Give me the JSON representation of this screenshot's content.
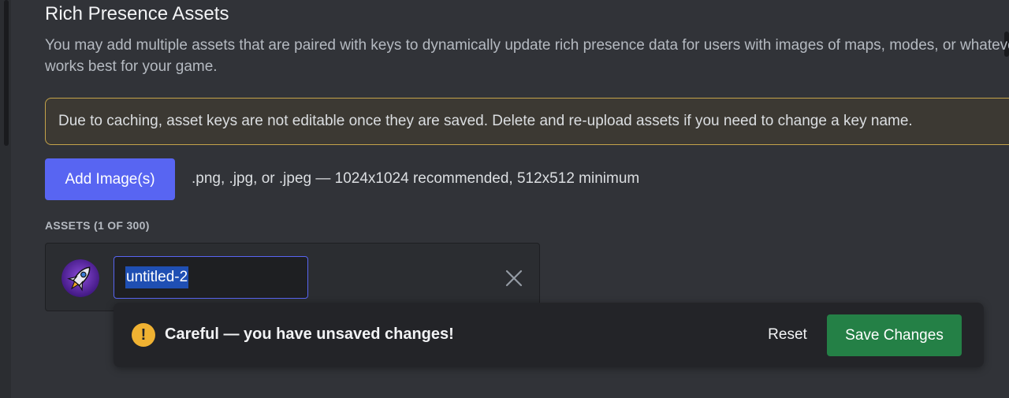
{
  "section": {
    "title": "Rich Presence Assets",
    "description": "You may add multiple assets that are paired with keys to dynamically update rich presence data for users with images of maps, modes, or whatever works best for your game."
  },
  "warning": {
    "text": "Due to caching, asset keys are not editable once they are saved. Delete and re-upload assets if you need to change a key name."
  },
  "upload": {
    "button_label": "Add Image(s)",
    "hint": ".png, .jpg, or .jpeg — 1024x1024 recommended, 512x512 minimum"
  },
  "assets": {
    "label": "ASSETS (1 OF 300)",
    "items": [
      {
        "key": "untitled-2",
        "thumbnail_icon": "rocket-icon"
      }
    ]
  },
  "unsaved_bar": {
    "message": "Careful — you have unsaved changes!",
    "reset_label": "Reset",
    "save_label": "Save Changes"
  },
  "colors": {
    "background": "#313338",
    "brand": "#5865f2",
    "save_green": "#248046",
    "warning_yellow": "#f0b232",
    "warning_border": "#c4a34a"
  }
}
